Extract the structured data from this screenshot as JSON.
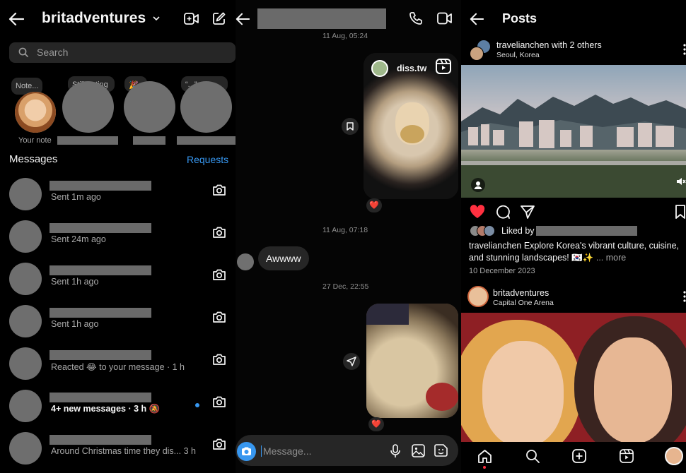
{
  "inbox": {
    "username": "britadventures",
    "search_placeholder": "Search",
    "notes": [
      {
        "bubble": "Note..."
      },
      {
        "bubble": "Still eating"
      },
      {
        "bubble": "🎉"
      },
      {
        "bubble": "“...”"
      }
    ],
    "your_note_label": "Your note",
    "messages_label": "Messages",
    "requests_label": "Requests",
    "threads": [
      {
        "sub": "Sent 1m ago",
        "bold": false
      },
      {
        "sub": "Sent 24m ago",
        "bold": false
      },
      {
        "sub": "Sent 1h ago",
        "bold": false
      },
      {
        "sub": "Sent 1h ago",
        "bold": false
      },
      {
        "sub": "Reacted 😂 to your message · 1 h",
        "bold": false
      },
      {
        "sub": "4+ new messages · 3 h 🔕",
        "bold": true
      },
      {
        "sub": "Around Christmas time they dis... 3 h",
        "bold": false
      }
    ],
    "accent": "#3797f0"
  },
  "chat": {
    "timestamps": [
      "11 Aug, 05:24",
      "11 Aug, 07:18",
      "27 Dec, 22:55"
    ],
    "reel_user": "diss.tw",
    "reply_text": "Awwww",
    "reactions": [
      "❤️",
      "❤️"
    ],
    "composer_placeholder": "Message..."
  },
  "posts": {
    "title": "Posts",
    "post1": {
      "user": "travelianchen with 2 others",
      "location": "Seoul, Korea",
      "liked_by_label": "Liked by",
      "caption_user": "travelianchen",
      "caption_text": " Explore Korea's vibrant culture, cuisine, and stunning landscapes! 🇰🇷✨",
      "more": "... more",
      "date": "10 December 2023"
    },
    "post2": {
      "user": "britadventures",
      "location": "Capital One Arena"
    },
    "like_color": "#ff3040"
  }
}
